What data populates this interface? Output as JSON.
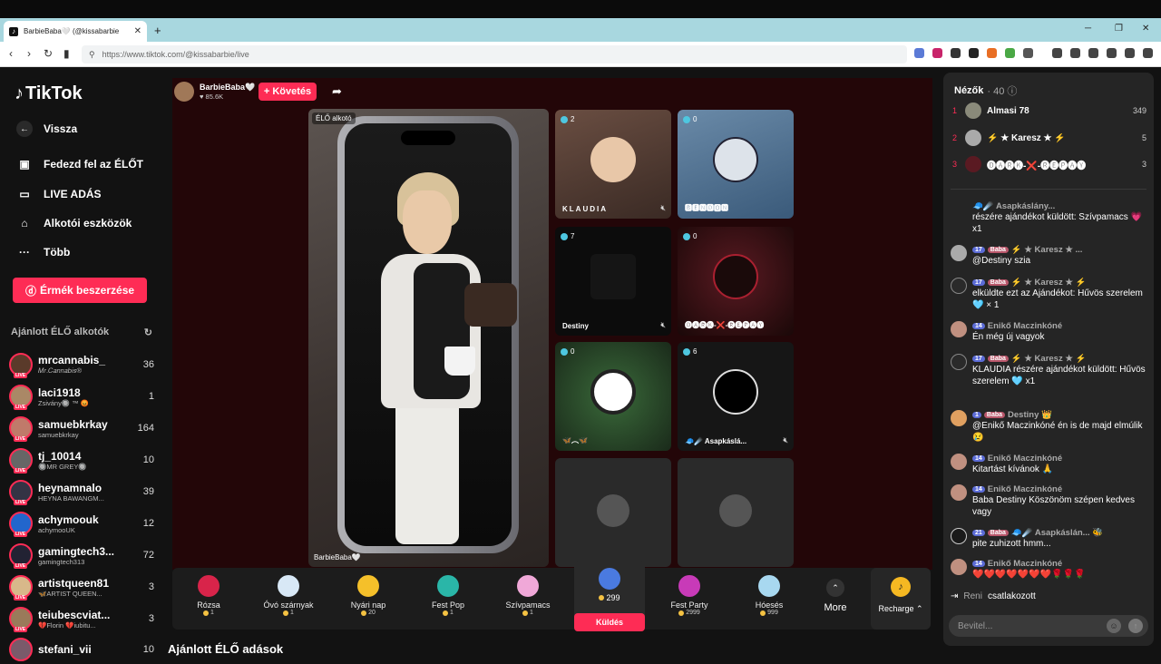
{
  "browser": {
    "tab_title": "BarbieBaba🤍 (@kissabarbie",
    "url": "https://www.tiktok.com/@kissabarbie/live"
  },
  "sidebar": {
    "logo": "TikTok",
    "back": "Vissza",
    "nav": [
      "Fedezd fel az ÉLŐT",
      "LIVE ADÁS",
      "Alkotói eszközök",
      "Több"
    ],
    "coins_button": "Érmék beszerzése",
    "recommended_title": "Ajánlott ÉLŐ alkotók",
    "creators": [
      {
        "name": "mrcannabis_",
        "sub": "𝑀𝑟.𝐶𝑎𝑛𝑛𝑎𝑏𝑖𝑠®",
        "count": "36"
      },
      {
        "name": "laci1918",
        "sub": "Zsivány🔘 ™ 😡",
        "count": "1"
      },
      {
        "name": "samuebkrkay",
        "sub": "samuebkrkay",
        "count": "164"
      },
      {
        "name": "tj_10014",
        "sub": "🔘MR GREY🔘",
        "count": "10"
      },
      {
        "name": "heynamnalo",
        "sub": "HEYNA BAWANGM...",
        "count": "39"
      },
      {
        "name": "achymoouk",
        "sub": "achymooUK",
        "count": "12"
      },
      {
        "name": "gamingtech3...",
        "sub": "gamingtech313",
        "count": "72"
      },
      {
        "name": "artistqueen81",
        "sub": "🦋ARTIST QUEEN...",
        "count": "3"
      },
      {
        "name": "teiubescviat...",
        "sub": "💔Florin 💔iubitu...",
        "count": "3"
      },
      {
        "name": "stefani_vii",
        "sub": "",
        "count": "10"
      }
    ],
    "live_badge": "LIVE"
  },
  "stream": {
    "host_name": "BarbieBaba🤍",
    "host_likes": "♥ 85.6K",
    "follow": "+ Követés",
    "live_tag": "ÉLŐ alkotó",
    "host_tag": "BarbieBaba🤍",
    "tiles": [
      {
        "count": "2",
        "name": "KLAUDIA"
      },
      {
        "count": "0",
        "name": "🅱🅴🅽🅳🅾🅽"
      },
      {
        "count": "7",
        "name": "Destiny"
      },
      {
        "count": "0",
        "name": "🅓🅐🅡🅚-❌-🅡🅔🅟🅐🅨"
      },
      {
        "count": "0",
        "name": "🦋︵🦋"
      },
      {
        "count": "6",
        "name": "🧢☄️ Asapkáslá..."
      }
    ]
  },
  "gifts": [
    {
      "name": "Rózsa",
      "price": "1"
    },
    {
      "name": "Óvó szárnyak",
      "price": "1"
    },
    {
      "name": "Nyári nap",
      "price": "20"
    },
    {
      "name": "Fest Pop",
      "price": "1"
    },
    {
      "name": "Szívpamacs",
      "price": "1"
    },
    {
      "name": "",
      "price": "299"
    },
    {
      "name": "Fest Party",
      "price": "2999"
    },
    {
      "name": "Hóesés",
      "price": "999"
    }
  ],
  "send_label": "Küldés",
  "more_label": "More",
  "recharge_label": "Recharge ⌃",
  "section_title": "Ajánlott ÉLŐ adások",
  "chat": {
    "viewers_title": "Nézők",
    "viewers_count": "· 40 ⓘ",
    "top_viewers": [
      {
        "rank": "1",
        "name": "Almasi 78",
        "score": "349"
      },
      {
        "rank": "2",
        "name": "⚡ ★ Karesz ★ ⚡",
        "score": "5"
      },
      {
        "rank": "3",
        "name": "🅓🅐🅡🅚-❌-🅡🅔🅟🅐🅨",
        "score": "3"
      }
    ],
    "messages": [
      {
        "head": "🧢☄️ Asapkáslány...",
        "lvl": "",
        "fan": "",
        "text": "részére ajándékot küldött: Szívpamacs 💗 x1"
      },
      {
        "head": "⚡ ★ Karesz ★ ...",
        "lvl": "17",
        "fan": "Baba",
        "text": "@Destiny szia"
      },
      {
        "head": "⚡ ★ Karesz ★ ⚡",
        "lvl": "17",
        "fan": "Baba",
        "text": "elküldte ezt az Ajándékot: Hűvös szerelem 🩵 × 1"
      },
      {
        "head": "Enikő Maczinkóné",
        "lvl": "14",
        "fan": "",
        "text": "Én még új vagyok"
      },
      {
        "head": "⚡ ★ Karesz ★ ⚡",
        "lvl": "17",
        "fan": "Baba",
        "text": "KLAUDIA részére ajándékot küldött: Hűvös szerelem 🩵 x1"
      },
      {
        "head": "Destiny 👑",
        "lvl": "1",
        "fan": "Baba",
        "text": "@Enikő Maczinkóné én is de majd elmúlik 😢"
      },
      {
        "head": "Enikő Maczinkóné",
        "lvl": "14",
        "fan": "",
        "text": "Kitartást kívánok 🙏"
      },
      {
        "head": "Enikő Maczinkóné",
        "lvl": "14",
        "fan": "",
        "text": "Baba Destiny Köszönöm szépen kedves vagy"
      },
      {
        "head": "🧢☄️ Asapkáslán... 🐝",
        "lvl": "21",
        "fan": "Baba",
        "text": "pite zuhizott hmm..."
      },
      {
        "head": "Enikő Maczinkóné",
        "lvl": "14",
        "fan": "",
        "text": "❤️❤️❤️❤️❤️❤️❤️🌹🌹🌹"
      }
    ],
    "join_name": "Reni",
    "join_text": "csatlakozott",
    "input_placeholder": "Bevitel..."
  }
}
